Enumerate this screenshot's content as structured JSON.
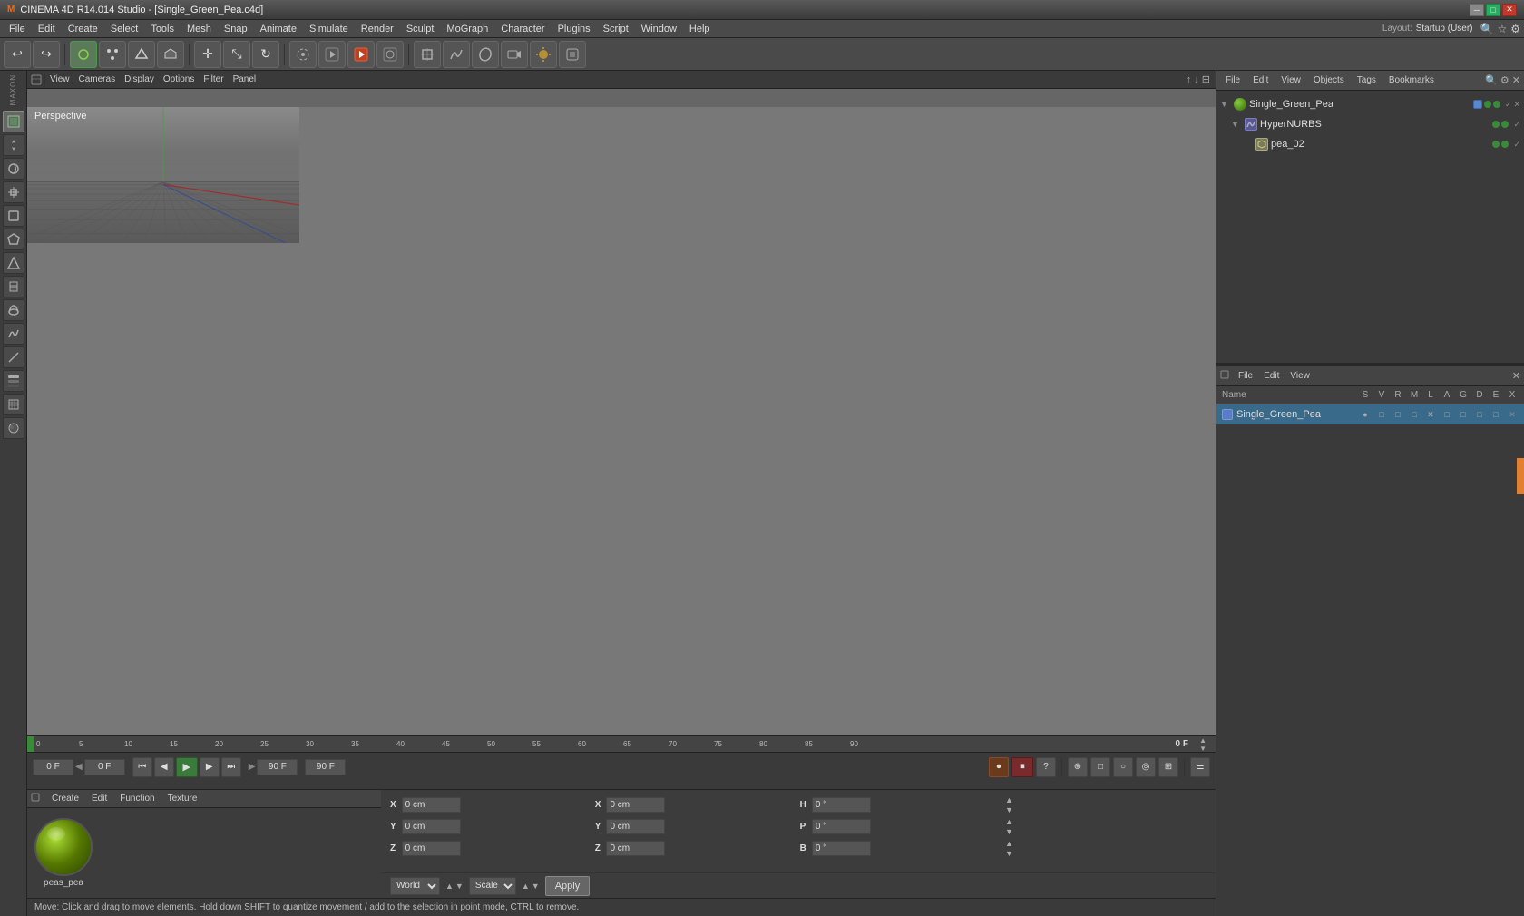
{
  "app": {
    "title": "CINEMA 4D R14.014 Studio - [Single_Green_Pea.c4d]",
    "layout_label": "Layout:",
    "layout_value": "Startup (User)"
  },
  "titlebar": {
    "minimize": "─",
    "maximize": "□",
    "close": "✕"
  },
  "menu": {
    "items": [
      "File",
      "Edit",
      "Create",
      "Select",
      "Tools",
      "Mesh",
      "Snap",
      "Animate",
      "Simulate",
      "Render",
      "Sculpt",
      "MoGraph",
      "Character",
      "Plugins",
      "Script",
      "Window",
      "Help"
    ]
  },
  "viewport": {
    "label": "Perspective",
    "toolbar": [
      "View",
      "Cameras",
      "Display",
      "Options",
      "Filter",
      "Panel"
    ]
  },
  "object_manager": {
    "toolbar": [
      "File",
      "Edit",
      "View",
      "Objects",
      "Tags",
      "Bookmarks"
    ],
    "search_placeholder": "Search",
    "items": [
      {
        "id": "root",
        "label": "Single_Green_Pea",
        "type": "root",
        "indent": 0
      },
      {
        "id": "nurbs",
        "label": "HyperNURBS",
        "type": "nurbs",
        "indent": 1
      },
      {
        "id": "pea",
        "label": "pea_02",
        "type": "mesh",
        "indent": 2
      }
    ]
  },
  "material_manager": {
    "toolbar": [
      "File",
      "Edit",
      "View"
    ],
    "columns": {
      "name": "Name",
      "s": "S",
      "v": "V",
      "r": "R",
      "m": "M",
      "l": "L",
      "a": "A",
      "g": "G",
      "d": "D",
      "e": "E",
      "x": "X"
    },
    "items": [
      {
        "label": "Single_Green_Pea",
        "color": "#4a5aa0"
      }
    ]
  },
  "material_thumb": {
    "create": "Create",
    "edit": "Edit",
    "function": "Function",
    "texture": "Texture",
    "label": "peas_pea"
  },
  "coordinates": {
    "x_pos": "0 cm",
    "y_pos": "0 cm",
    "z_pos": "0 cm",
    "x_size": "0 cm",
    "y_size": "0 cm",
    "z_size": "0 cm",
    "h": "0 °",
    "p": "0 °",
    "b": "0 °",
    "world_label": "World",
    "scale_label": "Scale",
    "apply_label": "Apply"
  },
  "timeline": {
    "current_frame": "0 F",
    "start_frame": "0 F",
    "end_frame": "90 F",
    "fps": "90 F",
    "markers": [
      "0",
      "5",
      "10",
      "15",
      "20",
      "25",
      "30",
      "35",
      "40",
      "45",
      "50",
      "55",
      "60",
      "65",
      "70",
      "75",
      "80",
      "85",
      "90"
    ]
  },
  "status_bar": {
    "message": "Move: Click and drag to move elements. Hold down SHIFT to quantize movement / add to the selection in point mode, CTRL to remove."
  },
  "left_tools": [
    {
      "icon": "⊞",
      "label": "select-tool"
    },
    {
      "icon": "↔",
      "label": "move-tool"
    },
    {
      "icon": "↻",
      "label": "rotate-tool"
    },
    {
      "icon": "⤡",
      "label": "scale-tool"
    },
    {
      "icon": "□",
      "label": "box-tool"
    },
    {
      "icon": "◈",
      "label": "polygon-tool"
    },
    {
      "icon": "△",
      "label": "triangle-tool"
    },
    {
      "icon": "◇",
      "label": "diamond-tool"
    },
    {
      "icon": "○",
      "label": "circle-tool"
    },
    {
      "icon": "∿",
      "label": "spline-tool"
    },
    {
      "icon": "⌒",
      "label": "arc-tool"
    },
    {
      "icon": "≋",
      "label": "grid-tool"
    },
    {
      "icon": "✦",
      "label": "star-tool"
    },
    {
      "icon": "☷",
      "label": "layer-tool"
    }
  ]
}
